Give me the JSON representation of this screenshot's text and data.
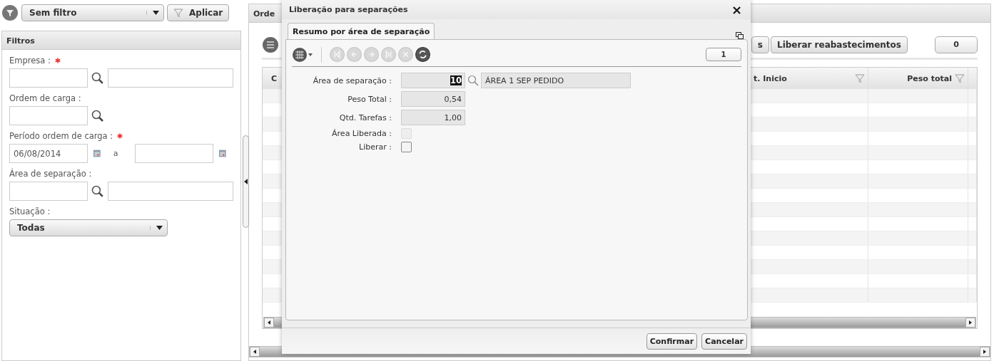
{
  "filter_bar": {
    "preset": "Sem filtro",
    "apply": "Aplicar"
  },
  "filters": {
    "title": "Filtros",
    "fields": [
      {
        "kind": "lookup",
        "label": "Empresa :",
        "required": true
      },
      {
        "kind": "code",
        "label": "Ordem de carga :",
        "required": false
      },
      {
        "kind": "daterange",
        "label": "Período ordem de carga :",
        "required": true,
        "from": "06/08/2014",
        "separator": "a"
      },
      {
        "kind": "lookup",
        "label": "Área de separação :",
        "required": false
      },
      {
        "kind": "select",
        "label": "Situação :",
        "required": false,
        "value": "Todas"
      }
    ]
  },
  "main": {
    "title": "Orde",
    "buttons": [
      "s",
      "Liberar reabastecimentos"
    ],
    "count": "0",
    "columns": [
      "C",
      "t. Inicio",
      "Peso total"
    ]
  },
  "dialog": {
    "title": "Liberação para separações",
    "close": "×",
    "tab": "Resumo por área de separação",
    "toolbar": [
      {
        "disabled": true
      },
      {
        "disabled": true
      },
      {
        "disabled": true
      },
      {
        "disabled": true
      },
      {
        "disabled": true
      },
      {
        "disabled": false
      }
    ],
    "record": "1",
    "fields": [
      {
        "kind": "lookup",
        "label": "Área de separação :",
        "value": "10",
        "selected": true,
        "description": "ÁREA 1 SEP PEDIDO"
      },
      {
        "kind": "number",
        "label": "Peso Total :",
        "value": "0,54"
      },
      {
        "kind": "number",
        "label": "Qtd. Tarefas :",
        "value": "1,00"
      },
      {
        "kind": "checkbox",
        "label": "Área Liberada :",
        "checked": false,
        "disabled": true
      },
      {
        "kind": "checkbox",
        "label": "Liberar :",
        "checked": false,
        "disabled": false
      }
    ],
    "buttons": [
      "Confirmar",
      "Cancelar"
    ]
  }
}
